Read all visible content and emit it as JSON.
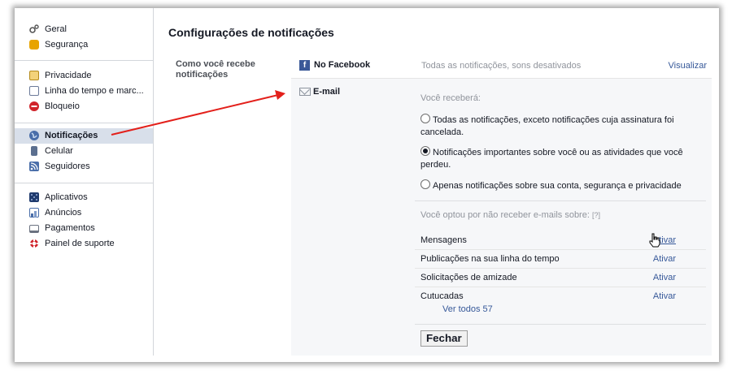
{
  "page_title": "Configurações de notificações",
  "sidebar": {
    "group1": [
      {
        "label": "Geral",
        "icon": "gears-icon",
        "color": "#6b7280"
      },
      {
        "label": "Segurança",
        "icon": "badge-icon",
        "color": "#e8a400"
      }
    ],
    "group2": [
      {
        "label": "Privacidade",
        "icon": "lock-icon",
        "color": "#c89b2e"
      },
      {
        "label": "Linha do tempo e marc...",
        "icon": "timeline-icon",
        "color": "#6b7a99"
      },
      {
        "label": "Bloqueio",
        "icon": "block-icon",
        "color": "#d0232a"
      }
    ],
    "group3": [
      {
        "label": "Notificações",
        "icon": "globe-icon",
        "color": "#4a6ea9",
        "active": true
      },
      {
        "label": "Celular",
        "icon": "phone-icon",
        "color": "#5b6f8f"
      },
      {
        "label": "Seguidores",
        "icon": "rss-icon",
        "color": "#4a6ea9"
      }
    ],
    "group4": [
      {
        "label": "Aplicativos",
        "icon": "apps-icon",
        "color": "#1f3a6d"
      },
      {
        "label": "Anúncios",
        "icon": "ads-icon",
        "color": "#4a6ea9"
      },
      {
        "label": "Pagamentos",
        "icon": "card-icon",
        "color": "#6b7280"
      },
      {
        "label": "Painel de suporte",
        "icon": "lifebuoy-icon",
        "color": "#d0232a"
      }
    ]
  },
  "main": {
    "how_label": "Como você recebe notificações",
    "facebook": {
      "label": "No Facebook",
      "summary": "Todas as notificações, sons desativados",
      "view": "Visualizar"
    },
    "email": {
      "label": "E-mail",
      "receive_label": "Você receberá:",
      "options": [
        {
          "text": "Todas as notificações, exceto notificações cuja assinatura foi cancelada.",
          "checked": false
        },
        {
          "text": "Notificações importantes sobre você ou as atividades que você perdeu.",
          "checked": true
        },
        {
          "text": "Apenas notificações sobre sua conta, segurança e privacidade",
          "checked": false
        }
      ],
      "optout_label": "Você optou por não receber e-mails sobre:",
      "help": "[?]",
      "optout_rows": [
        {
          "name": "Mensagens",
          "action": "Ativar"
        },
        {
          "name": "Publicações na sua linha do tempo",
          "action": "Ativar"
        },
        {
          "name": "Solicitações de amizade",
          "action": "Ativar"
        },
        {
          "name": "Cutucadas",
          "action": "Ativar"
        }
      ],
      "see_all": "Ver todos 57",
      "close": "Fechar"
    }
  },
  "colors": {
    "accent": "#365899",
    "annotation_arrow": "#e3201b",
    "active_bg": "#d8dfea"
  }
}
